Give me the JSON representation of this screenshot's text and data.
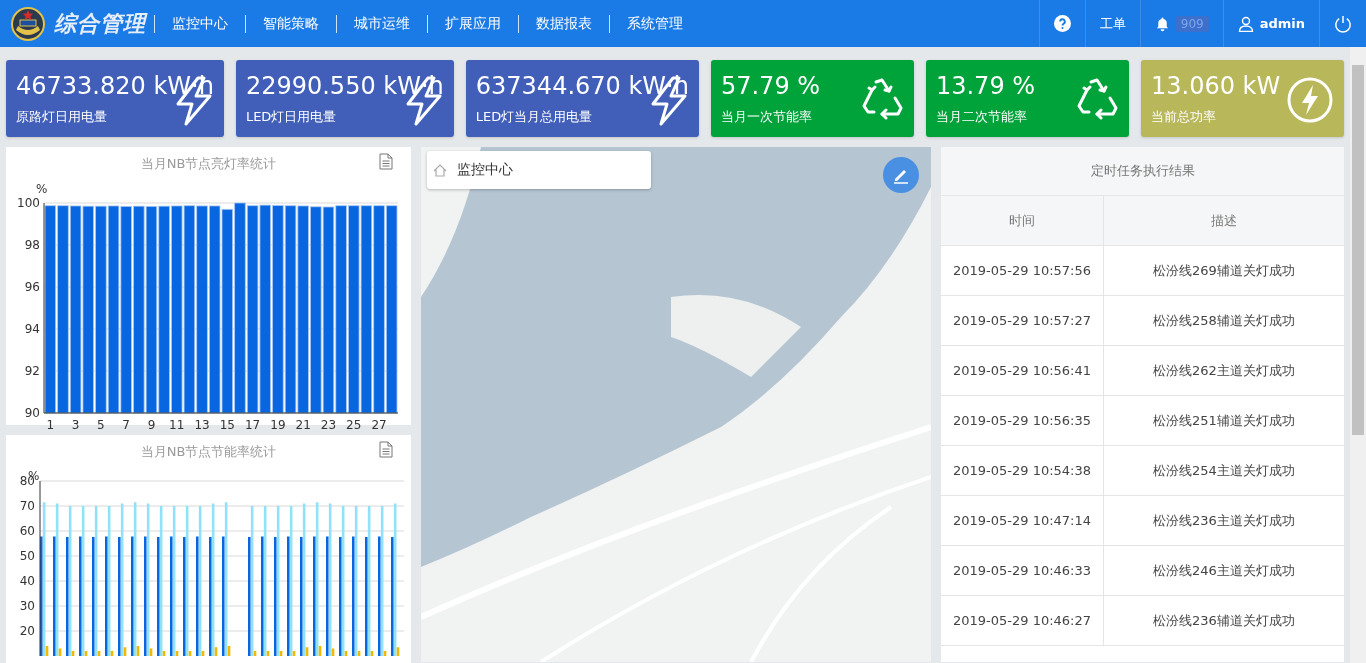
{
  "header": {
    "title": "综合管理",
    "nav": [
      {
        "label": "监控中心"
      },
      {
        "label": "智能策略"
      },
      {
        "label": "城市运维"
      },
      {
        "label": "扩展应用"
      },
      {
        "label": "数据报表"
      },
      {
        "label": "系统管理"
      }
    ],
    "tickets": "工单",
    "alerts": "909",
    "user": "admin"
  },
  "stats": [
    {
      "value": "46733.820 kW·h",
      "label": "原路灯日用电量",
      "kind": "energy",
      "color": "#415fb9"
    },
    {
      "value": "22990.550 kW·h",
      "label": "LED灯日用电量",
      "kind": "energy",
      "color": "#415fb9"
    },
    {
      "value": "637344.670 kW·h",
      "label": "LED灯当月总用电量",
      "kind": "energy",
      "color": "#415fb9"
    },
    {
      "value": "57.79 %",
      "label": "当月一次节能率",
      "kind": "recycle",
      "color": "#00a23a"
    },
    {
      "value": "13.79 %",
      "label": "当月二次节能率",
      "kind": "recycle",
      "color": "#00a23a"
    },
    {
      "value": "13.060 kW",
      "label": "当前总功率",
      "kind": "power",
      "color": "#b8b75a"
    }
  ],
  "lighting_chart": {
    "chart_data": {
      "type": "bar",
      "title": "当月NB节点亮灯率统计",
      "ylabel": "%",
      "grid": true,
      "x": [
        1,
        2,
        3,
        4,
        5,
        6,
        7,
        8,
        9,
        10,
        11,
        12,
        13,
        14,
        15,
        16,
        17,
        18,
        19,
        20,
        21,
        22,
        23,
        24,
        25,
        26,
        27,
        28
      ],
      "series": [
        {
          "color": "#0866e0",
          "values": [
            99.87,
            99.87,
            99.86,
            99.85,
            99.85,
            99.86,
            99.84,
            99.85,
            99.84,
            99.85,
            99.86,
            99.87,
            99.86,
            99.86,
            99.7,
            100,
            99.87,
            99.9,
            99.88,
            99.87,
            99.86,
            99.82,
            99.81,
            99.87,
            99.87,
            99.87,
            99.87,
            99.87
          ]
        }
      ],
      "ylim": [
        90,
        100
      ],
      "yticks": [
        90,
        92,
        94,
        96,
        98,
        100
      ],
      "xlim": [
        0.5,
        28.5
      ],
      "xticks": [
        1,
        3,
        5,
        7,
        9,
        11,
        13,
        15,
        17,
        19,
        21,
        23,
        25,
        27
      ]
    }
  },
  "saving_chart": {
    "chart_data": {
      "type": "bar",
      "title": "当月NB节点节能率统计",
      "ylabel": "%",
      "grid": true,
      "series": [
        {
          "color": "#0866e0",
          "values": [
            57.8,
            57.8,
            57.6,
            57.8,
            57.6,
            57.8,
            57.6,
            57.8,
            57.8,
            57.6,
            57.8,
            57.6,
            57.8,
            57.6,
            57.8,
            null,
            57.6,
            57.8,
            57.6,
            57.8,
            57.6,
            57.8,
            57.8,
            57.6,
            57.8,
            57.6,
            57.8,
            57.6
          ]
        },
        {
          "color": "#8fe2f7",
          "values": [
            71.5,
            71,
            70,
            70,
            70,
            70,
            71,
            71.5,
            71,
            70,
            70,
            70,
            70,
            71,
            71.5,
            null,
            70,
            70,
            70,
            70,
            71,
            71.5,
            71,
            70,
            70,
            70,
            70,
            71
          ]
        },
        {
          "color": "#f5b800",
          "values": [
            14,
            13,
            12,
            12,
            12,
            12,
            13.5,
            14,
            13,
            12,
            12,
            12,
            12,
            13.5,
            14,
            null,
            12,
            12,
            12,
            12,
            13.5,
            14,
            13,
            12,
            12,
            12,
            12,
            13.5
          ]
        }
      ],
      "ylim": [
        10,
        80
      ],
      "yticks": [
        20,
        30,
        40,
        50,
        60,
        70,
        80
      ]
    }
  },
  "map": {
    "breadcrumb": "监控中心"
  },
  "tasks": {
    "title": "定时任务执行结果",
    "columns": [
      "时间",
      "描述"
    ],
    "rows": [
      [
        "2019-05-29 10:57:56",
        "松汾线269辅道关灯成功"
      ],
      [
        "2019-05-29 10:57:27",
        "松汾线258辅道关灯成功"
      ],
      [
        "2019-05-29 10:56:41",
        "松汾线262主道关灯成功"
      ],
      [
        "2019-05-29 10:56:35",
        "松汾线251辅道关灯成功"
      ],
      [
        "2019-05-29 10:54:38",
        "松汾线254主道关灯成功"
      ],
      [
        "2019-05-29 10:47:14",
        "松汾线236主道关灯成功"
      ],
      [
        "2019-05-29 10:46:33",
        "松汾线246主道关灯成功"
      ],
      [
        "2019-05-29 10:46:27",
        "松汾线236辅道关灯成功"
      ]
    ]
  }
}
